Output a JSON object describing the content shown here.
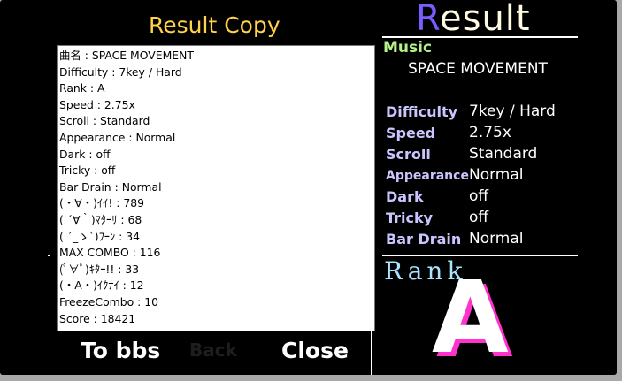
{
  "result_panel": {
    "title_first_letter": "R",
    "title_rest": "esult",
    "music_label": "Music",
    "music_title": "SPACE MOVEMENT",
    "stats": [
      {
        "label": "Difficulty",
        "value": "7key / Hard"
      },
      {
        "label": "Speed",
        "value": "2.75x"
      },
      {
        "label": "Scroll",
        "value": "Standard"
      },
      {
        "label": "Appearance",
        "value": "Normal"
      },
      {
        "label": "Dark",
        "value": "off"
      },
      {
        "label": "Tricky",
        "value": "off"
      },
      {
        "label": "Bar Drain",
        "value": "Normal"
      }
    ],
    "rank_label": "Rank",
    "rank": "A"
  },
  "copy_dialog": {
    "title": "Result Copy",
    "lines": [
      "曲名 : SPACE MOVEMENT",
      "Difficulty : 7key / Hard",
      "Rank : A",
      "Speed : 2.75x",
      "Scroll : Standard",
      "Appearance : Normal",
      "Dark : off",
      "Tricky : off",
      "Bar Drain : Normal",
      "(・∀・)ｲｲ! : 789",
      "( ´∀｀)ﾏﾀｰﾘ : 68",
      "( ´_ゝ`)ﾌｰﾝ : 34",
      "MAX COMBO : 116",
      "(ﾟ∀ﾟ)ｷﾀｰ!! : 33",
      "(・A・)ｲｸﾅｲ : 12",
      "FreezeCombo : 10",
      "Score : 18421"
    ]
  },
  "buttons": {
    "bbs": "To bbs",
    "back": "Back",
    "close": "Close"
  },
  "colors": {
    "background": "#000000",
    "copy_title": "#ffd24a",
    "music_label": "#b6f28a",
    "stat_label": "#c9c6ff",
    "rank_label": "#a8e4ff",
    "rank_shadow": "#ff33cc",
    "title_R": "#7b5cff"
  }
}
